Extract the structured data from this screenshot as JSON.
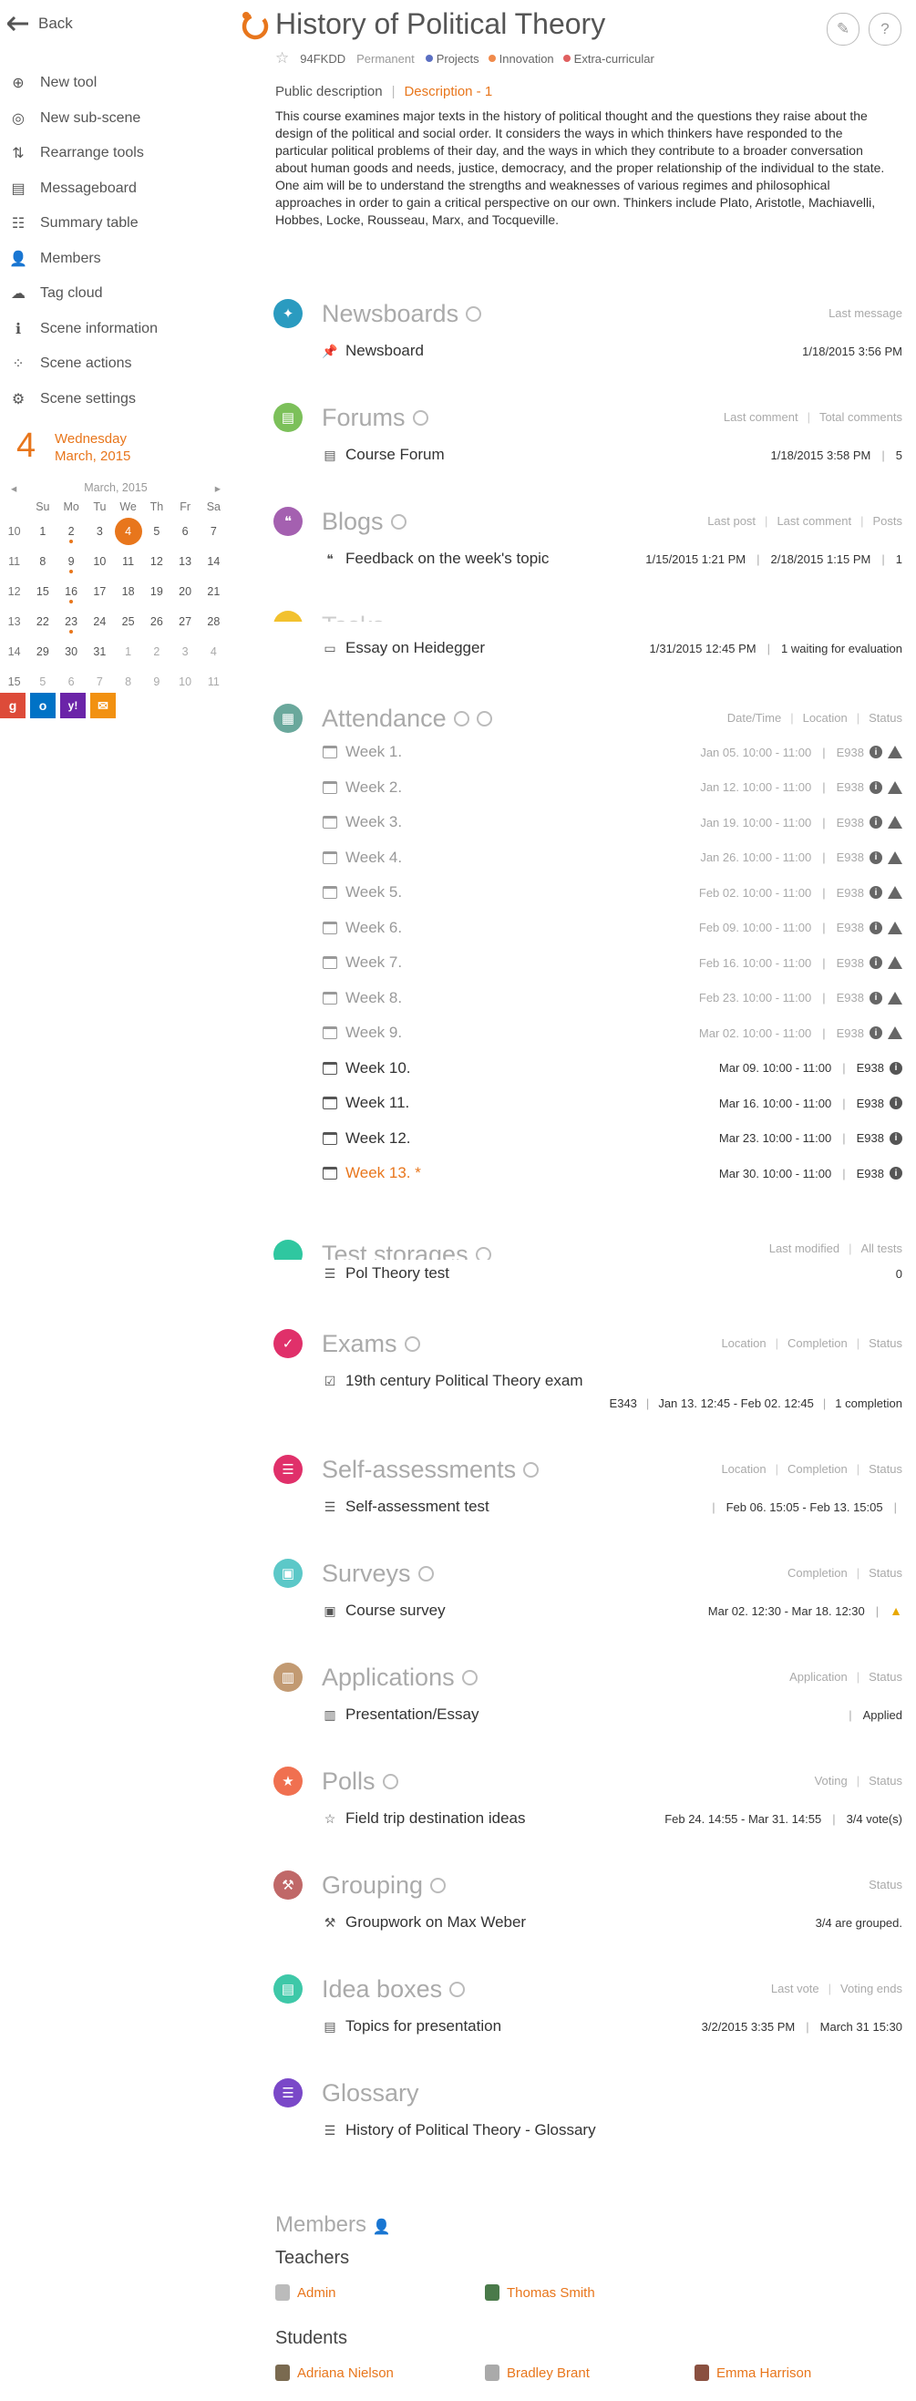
{
  "sidebar": {
    "back": "Back",
    "items": [
      {
        "label": "New tool",
        "icon": "new-tool-icon"
      },
      {
        "label": "New sub-scene",
        "icon": "new-subscene-icon"
      },
      {
        "label": "Rearrange tools",
        "icon": "rearrange-icon"
      },
      {
        "label": "Messageboard",
        "icon": "messageboard-icon"
      },
      {
        "label": "Summary table",
        "icon": "summary-table-icon"
      },
      {
        "label": "Members",
        "icon": "members-icon"
      },
      {
        "label": "Tag cloud",
        "icon": "tag-cloud-icon"
      },
      {
        "label": "Scene information",
        "icon": "info-icon"
      },
      {
        "label": "Scene actions",
        "icon": "actions-icon"
      },
      {
        "label": "Scene settings",
        "icon": "settings-icon"
      }
    ],
    "day_number": "4",
    "day_name": "Wednesday",
    "month_year": "March, 2015",
    "calendar": {
      "title": "March, 2015",
      "weekdays": [
        "Su",
        "Mo",
        "Tu",
        "We",
        "Th",
        "Fr",
        "Sa"
      ],
      "weeks": [
        {
          "wk": "10",
          "days": [
            "1",
            "2",
            "3",
            "4",
            "5",
            "6",
            "7"
          ]
        },
        {
          "wk": "11",
          "days": [
            "8",
            "9",
            "10",
            "11",
            "12",
            "13",
            "14"
          ]
        },
        {
          "wk": "12",
          "days": [
            "15",
            "16",
            "17",
            "18",
            "19",
            "20",
            "21"
          ]
        },
        {
          "wk": "13",
          "days": [
            "22",
            "23",
            "24",
            "25",
            "26",
            "27",
            "28"
          ]
        },
        {
          "wk": "14",
          "days": [
            "29",
            "30",
            "31",
            "1",
            "2",
            "3",
            "4"
          ]
        },
        {
          "wk": "15",
          "days": [
            "5",
            "6",
            "7",
            "8",
            "9",
            "10",
            "11"
          ]
        }
      ]
    },
    "socials": [
      "g",
      "o",
      "y!",
      "✉"
    ]
  },
  "header": {
    "title": "History of Political Theory",
    "code": "94FKDD",
    "permanence": "Permanent",
    "tags": [
      {
        "label": "Projects",
        "color": "#5b6fc2"
      },
      {
        "label": "Innovation",
        "color": "#f08a4b"
      },
      {
        "label": "Extra-curricular",
        "color": "#e06060"
      }
    ],
    "desc_tab_public": "Public description",
    "desc_tab_active": "Description - 1",
    "description": "This course examines major texts in the history of political thought and the questions they raise about the design of the political and social order. It considers the ways in which thinkers have responded to the particular political problems of their day, and the ways in which they contribute to a broader conversation about human goods and needs, justice, democracy, and the proper relationship of the individual to the state. One aim will be to understand the strengths and weaknesses of various regimes and philosophical approaches in order to gain a critical perspective on our own. Thinkers include Plato, Aristotle, Machiavelli, Hobbes, Locke, Rousseau, Marx, and Tocqueville."
  },
  "sections": {
    "newsboards": {
      "title": "Newsboards",
      "col1": "Last message",
      "item": "Newsboard",
      "date": "1/18/2015 3:56 PM",
      "color": "#2a9bc0"
    },
    "forums": {
      "title": "Forums",
      "col1": "Last comment",
      "col2": "Total comments",
      "item": "Course Forum",
      "date": "1/18/2015 3:58 PM",
      "count": "5",
      "color": "#7cc05a"
    },
    "blogs": {
      "title": "Blogs",
      "col1": "Last post",
      "col2": "Last comment",
      "col3": "Posts",
      "item": "Feedback on the week's topic",
      "post": "1/15/2015 1:21 PM",
      "comment": "2/18/2015 1:15 PM",
      "count": "1",
      "color": "#a460b0"
    },
    "tasks": {
      "title": "Tasks",
      "item": "Essay on Heidegger",
      "date": "1/31/2015 12:45 PM",
      "status": "1 waiting for evaluation",
      "color": "#f2c12e"
    },
    "attendance": {
      "title": "Attendance",
      "col1": "Date/Time",
      "col2": "Location",
      "col3": "Status",
      "color": "#6aa89c",
      "weeks": [
        {
          "label": "Week 1.",
          "time": "Jan 05. 10:00 - 11:00",
          "room": "E938"
        },
        {
          "label": "Week 2.",
          "time": "Jan 12. 10:00 - 11:00",
          "room": "E938"
        },
        {
          "label": "Week 3.",
          "time": "Jan 19. 10:00 - 11:00",
          "room": "E938"
        },
        {
          "label": "Week 4.",
          "time": "Jan 26. 10:00 - 11:00",
          "room": "E938"
        },
        {
          "label": "Week 5.",
          "time": "Feb 02. 10:00 - 11:00",
          "room": "E938"
        },
        {
          "label": "Week 6.",
          "time": "Feb 09. 10:00 - 11:00",
          "room": "E938"
        },
        {
          "label": "Week 7.",
          "time": "Feb 16. 10:00 - 11:00",
          "room": "E938"
        },
        {
          "label": "Week 8.",
          "time": "Feb 23. 10:00 - 11:00",
          "room": "E938"
        },
        {
          "label": "Week 9.",
          "time": "Mar 02. 10:00 - 11:00",
          "room": "E938"
        },
        {
          "label": "Week 10.",
          "time": "Mar 09. 10:00 - 11:00",
          "room": "E938"
        },
        {
          "label": "Week 11.",
          "time": "Mar 16. 10:00 - 11:00",
          "room": "E938"
        },
        {
          "label": "Week 12.",
          "time": "Mar 23. 10:00 - 11:00",
          "room": "E938"
        },
        {
          "label": "Week 13. *",
          "time": "Mar 30. 10:00 - 11:00",
          "room": "E938"
        }
      ]
    },
    "tests": {
      "title": "Test storages",
      "col1": "Last modified",
      "col2": "All tests",
      "item": "Pol Theory test",
      "count": "0",
      "color": "#2fc7a0"
    },
    "exams": {
      "title": "Exams",
      "col1": "Location",
      "col2": "Completion",
      "col3": "Status",
      "item": "19th century Political Theory exam",
      "room": "E343",
      "period": "Jan 13. 12:45 - Feb 02. 12:45",
      "status": "1 completion",
      "color": "#e0306a"
    },
    "selfassess": {
      "title": "Self-assessments",
      "col1": "Location",
      "col2": "Completion",
      "col3": "Status",
      "item": "Self-assessment test",
      "period": "Feb 06. 15:05 - Feb 13. 15:05",
      "color": "#e0306a"
    },
    "surveys": {
      "title": "Surveys",
      "col1": "Completion",
      "col2": "Status",
      "item": "Course survey",
      "period": "Mar 02. 12:30 - Mar 18. 12:30",
      "color": "#5cc8c8"
    },
    "applications": {
      "title": "Applications",
      "col1": "Application",
      "col2": "Status",
      "item": "Presentation/Essay",
      "status": "Applied",
      "color": "#c29a72"
    },
    "polls": {
      "title": "Polls",
      "col1": "Voting",
      "col2": "Status",
      "item": "Field trip destination ideas",
      "period": "Feb 24. 14:55 - Mar 31. 14:55",
      "status": "3/4 vote(s)",
      "color": "#f07050"
    },
    "grouping": {
      "title": "Grouping",
      "col1": "Status",
      "item": "Groupwork on Max Weber",
      "status": "3/4 are grouped.",
      "color": "#c06868"
    },
    "ideas": {
      "title": "Idea boxes",
      "col1": "Last vote",
      "col2": "Voting ends",
      "item": "Topics for presentation",
      "vote": "3/2/2015 3:35 PM",
      "ends": "March 31 15:30",
      "color": "#3ec8a8"
    },
    "glossary": {
      "title": "Glossary",
      "item": "History of Political Theory - Glossary",
      "color": "#7a48c8"
    }
  },
  "members": {
    "title": "Members",
    "teachers_label": "Teachers",
    "teachers": [
      "Admin",
      "Thomas Smith"
    ],
    "students_label": "Students",
    "students": [
      "Adriana Nielson",
      "Bradley Brant",
      "Emma Harrison"
    ]
  }
}
